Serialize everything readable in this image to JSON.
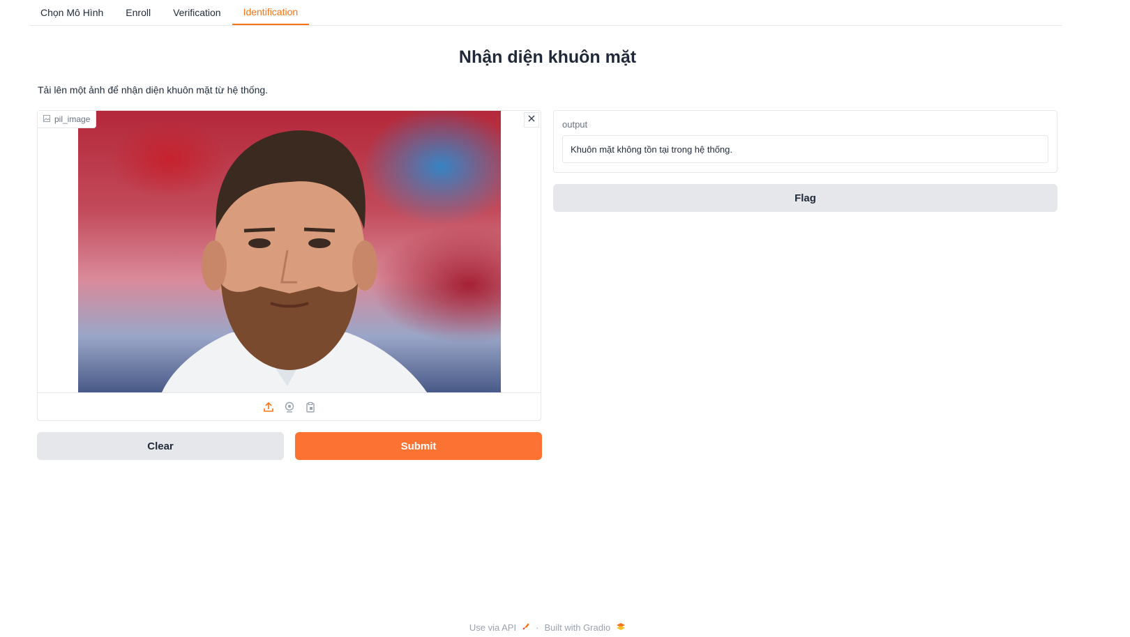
{
  "tabs": [
    {
      "label": "Chọn Mô Hình",
      "active": false
    },
    {
      "label": "Enroll",
      "active": false
    },
    {
      "label": "Verification",
      "active": false
    },
    {
      "label": "Identification",
      "active": true
    }
  ],
  "page": {
    "title": "Nhận diện khuôn mặt",
    "description": "Tải lên một ảnh để nhận diện khuôn mặt từ hệ thống."
  },
  "image_input": {
    "label": "pil_image",
    "tools": [
      "upload-icon",
      "webcam-icon",
      "clipboard-icon"
    ]
  },
  "buttons": {
    "clear": "Clear",
    "submit": "Submit",
    "flag": "Flag"
  },
  "output": {
    "label": "output",
    "value": "Khuôn mặt không tồn tại trong hệ thống."
  },
  "footer": {
    "api": "Use via API",
    "separator": "·",
    "built": "Built with Gradio"
  },
  "colors": {
    "accent": "#fb7233",
    "tab_active": "#f97316",
    "secondary_button": "#e5e7eb"
  }
}
